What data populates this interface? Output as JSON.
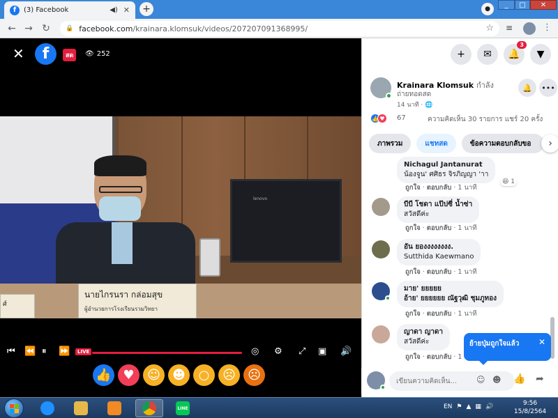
{
  "browser": {
    "tab_title": "(3) Facebook",
    "url_host": "facebook.com",
    "url_path": "/krainara.klomsuk/videos/207207091368995/"
  },
  "video": {
    "viewers": "252",
    "live_label": "สด",
    "live_pill": "LIVE",
    "nameplate_name": "นายไกรนรา  กล่อมสุข",
    "nameplate_title": "ผู้อำนวยการโรงเรียนรวมวิทยา",
    "nameplate_left": "ศ์",
    "monitor_brand": "lenovo",
    "reactions": [
      "like",
      "love",
      "care",
      "haha",
      "wow",
      "sad",
      "angry"
    ]
  },
  "side": {
    "notifications_count": "3",
    "poster_name": "Krainara Klomsuk",
    "poster_suffix": "กำลัง",
    "poster_line2": "ถ่ายทอดสด",
    "poster_time": "14 นาที · ",
    "reaction_count": "67",
    "comments_shares": "ความคิดเห็น 30 รายการ  แชร์ 20 ครั้ง",
    "tabs": [
      "ภาพรวม",
      "แชทสด",
      "ข้อความตอบกลับขอ"
    ],
    "comments": [
      {
        "name": "Nichagul Jantanurat",
        "text": "น้องจูน' ศศิธร จิรภิญญา 'าา",
        "meta_like": "ถูกใจ",
        "meta_reply": "ตอบกลับ",
        "time": "1 นาที",
        "react": "1"
      },
      {
        "name": "บีบี โชดา แป๊ปซี่ น้ำซ่า",
        "text": "สวัสดีค่ะ",
        "meta_like": "ถูกใจ",
        "meta_reply": "ตอบกลับ",
        "time": "1 นาที"
      },
      {
        "name": "อัน ยองงงงงงงง.",
        "text": "Sutthida Kaewmano",
        "meta_like": "ถูกใจ",
        "meta_reply": "ตอบกลับ",
        "time": "1 นาที"
      },
      {
        "name": "มาย' ยยยยย",
        "text": "อ้าย' ยยยยยย ณัฐวุฒิ ชุมภูทอง",
        "meta_like": "ถูกใจ",
        "meta_reply": "ตอบกลับ",
        "time": "1 นาที"
      },
      {
        "name": "ญาดา ญาดา",
        "text": "สวัสดีค่ะ",
        "meta_like": "ถูกใจ",
        "meta_reply": "ตอบกลับ",
        "time": "1 นาที"
      }
    ],
    "toast": "ย้ายปุ่มถูกใจแล้ว",
    "composer_placeholder": "เขียนความคิดเห็น..."
  },
  "taskbar": {
    "lang": "EN",
    "time": "9:56",
    "date": "15/8/2564",
    "line_label": "LINE"
  }
}
